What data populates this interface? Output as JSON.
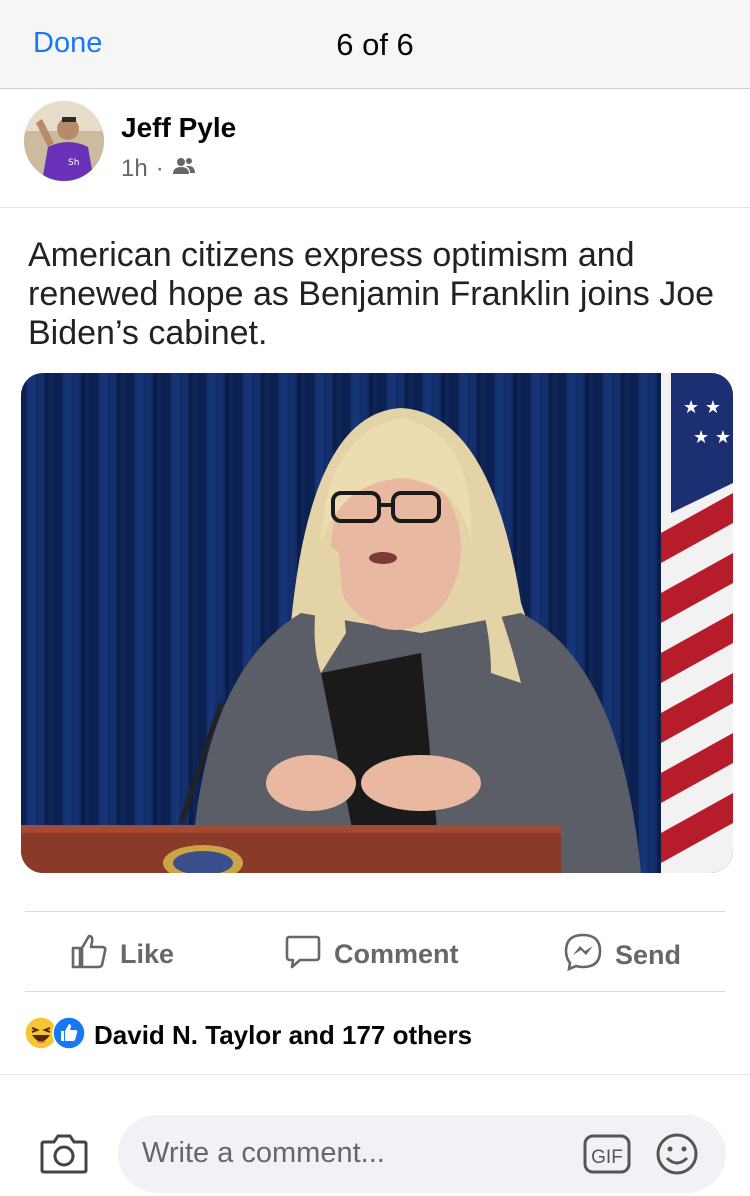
{
  "topbar": {
    "done_label": "Done",
    "pager": "6 of 6"
  },
  "post": {
    "author": "Jeff Pyle",
    "time": "1h",
    "separator": "·",
    "audience_icon": "friends-icon",
    "text": "American citizens express optimism and renewed hope as Benjamin Franklin joins Joe Biden’s cabinet."
  },
  "actions": {
    "like": "Like",
    "comment": "Comment",
    "send": "Send"
  },
  "reactions": {
    "summary": "David N. Taylor and 177 others",
    "icons": [
      "haha-icon",
      "like-icon"
    ]
  },
  "composer": {
    "placeholder": "Write a comment...",
    "gif_label": "GIF"
  },
  "colors": {
    "accent": "#1877f2",
    "muted": "#65676b",
    "bar_bg": "#f6f6f7"
  }
}
